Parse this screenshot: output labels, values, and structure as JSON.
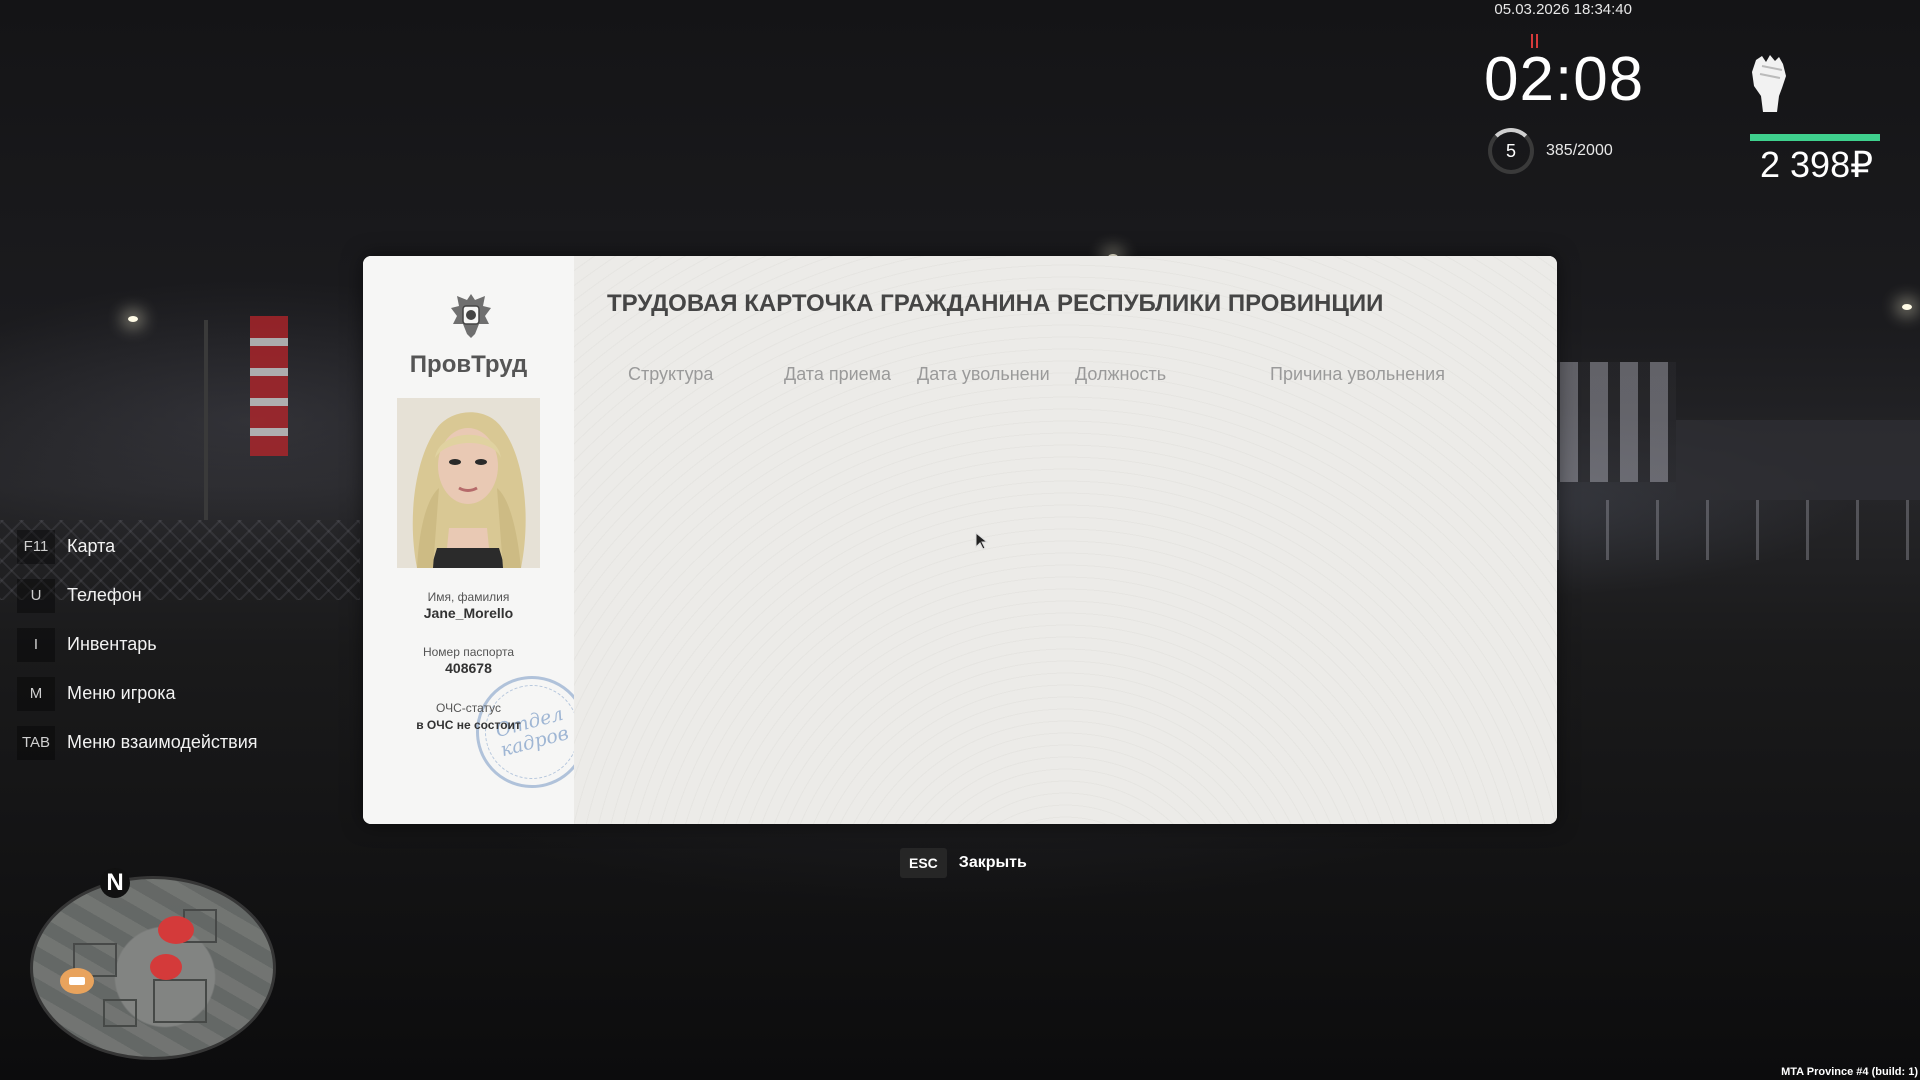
{
  "hud": {
    "datetime": "05.03.2026 18:34:40",
    "clock": "02:08",
    "level": "5",
    "xp": "385/2000",
    "money": "2 398₽",
    "hunger_icon": "fork-knife-icon",
    "strength_icon": "fist-icon",
    "health_color": "#3fd18e"
  },
  "menu": {
    "items": [
      {
        "key": "F11",
        "label": "Карта"
      },
      {
        "key": "U",
        "label": "Телефон"
      },
      {
        "key": "I",
        "label": "Инвентарь"
      },
      {
        "key": "M",
        "label": "Меню игрока"
      },
      {
        "key": "TAB",
        "label": "Меню взаимодействия"
      }
    ]
  },
  "card": {
    "brand": "ПровТруд",
    "title": "ТРУДОВАЯ КАРТОЧКА ГРАЖДАНИНА РЕСПУБЛИКИ ПРОВИНЦИИ",
    "columns": [
      "Структура",
      "Дата приема",
      "Дата увольнени",
      "Должность",
      "Причина увольнения"
    ],
    "name_label": "Имя, фамилия",
    "name_value": "Jane_Morello",
    "passport_label": "Номер паспорта",
    "passport_value": "408678",
    "status_label": "ОЧС-статус",
    "status_value": "в ОЧС не состоит",
    "stamp_line1": "Отдел",
    "stamp_line2": "кадров"
  },
  "close": {
    "key": "ESC",
    "label": "Закрыть"
  },
  "minimap": {
    "north": "N"
  },
  "build": "MTA Province #4 (build: 1)"
}
